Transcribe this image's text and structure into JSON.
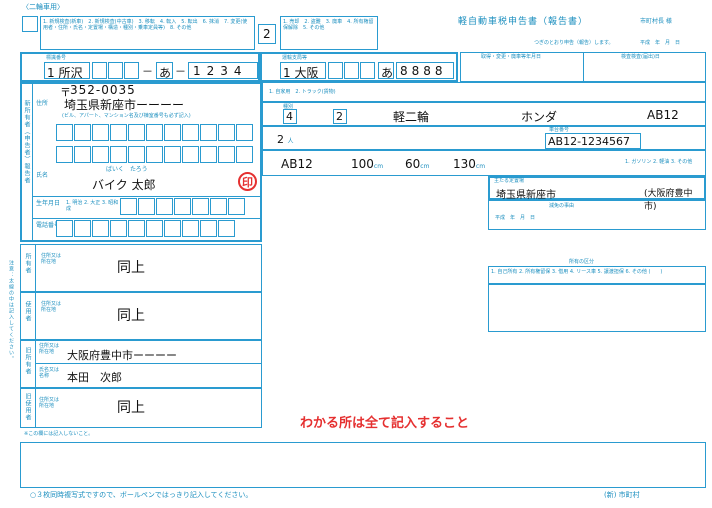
{
  "header": {
    "category": "〈二輪車用〉",
    "title": "軽自動車税申告書（報告書）",
    "addressee": "市町村長 様",
    "date_note": "つぎのとおり申告（報告）します。",
    "date_label": "平成　年　月　日",
    "reason_options": "1. 新規検査(新車)　2. 新規検査(中古車)　3. 移転　4. 転入　5. 転出　6. 抹消　7. 変更(使用者・住所・氏名・定置場・構造・種別・乗車定員等)　8. その他",
    "reason_code": "2",
    "reason_options2": "1. 売却　2. 盗難　3. 廃車　4. 所有権留保解除　5. その他",
    "registration_date_label": "取得・変更・廃車等年月日",
    "inspection_label": "検査検査(届出)日"
  },
  "plates": {
    "old_label": "標識番号",
    "old_region": "1 所沢",
    "old_class": "",
    "old_kana": "あ",
    "old_number": "1234",
    "new_label": "運輸支局等",
    "new_region": "1 大阪",
    "new_kana": "あ",
    "new_number": "8888"
  },
  "owner_new": {
    "postal": "352-0035",
    "postal_prefix": "〒",
    "address": "埼玉県新座市ーーーー",
    "building_hint": "(ビル、アパート、マンション名及び棟室番号も必ず記入)",
    "furigana": "ばいく　たろう",
    "name": "バイク 太郎",
    "seal": "印",
    "birth_label": "生年月日",
    "birth_options": "1. 明治 2. 大正 3. 昭和 4. 平成",
    "phone_label": "電話番号"
  },
  "vehicle": {
    "use_label": "1. 自家用　2. トラック(貨物)",
    "type_label": "種別",
    "type_value": "4",
    "use_class": "2",
    "body_shape": "軽二輪",
    "maker": "ホンダ",
    "model": "AB12",
    "chassis_label": "車台番号",
    "chassis": "AB12-1234567",
    "capacity": "2",
    "capacity_unit": "人",
    "engine_model": "AB12",
    "length": "100",
    "width": "60",
    "height": "130",
    "unit_cm": "cm",
    "fuel_options": "1. ガソリン 2. 軽油 3. その他"
  },
  "location": {
    "storage_label": "主たる定置場",
    "storage": "埼玉県新座市",
    "storage_note": "(大阪府豊中市)",
    "exemption_label": "減免の事由",
    "exemption_period": "平成　年　月　日",
    "ownership_label": "所有の区分",
    "ownership_options": "1. 自己所有 2. 所有権留保 3. 借用 4. リース車 5. 譲渡担保 6. その他 (　　)"
  },
  "sections": {
    "owner_same_label": "所有者",
    "owner_same": "同上",
    "user_label": "使用者",
    "user_same": "同上",
    "old_owner_label": "旧所有者",
    "old_owner_address": "大阪府豊中市ーーーー",
    "old_owner_name": "本田　次郎",
    "old_user_label": "旧使用者",
    "old_user_same": "同上",
    "address_label": "住所又は所在地",
    "name_label": "氏名又は名称"
  },
  "notes": {
    "instruction": "わかる所は全て記入すること",
    "footer_left": "○３枚同時複写式ですので、ボールペンではっきり記入してください。",
    "footer_right": "(新) 市町村",
    "no_entry": "※この欄には記入しないこと。",
    "side_note": "注意：太線の中は記入してください。"
  }
}
